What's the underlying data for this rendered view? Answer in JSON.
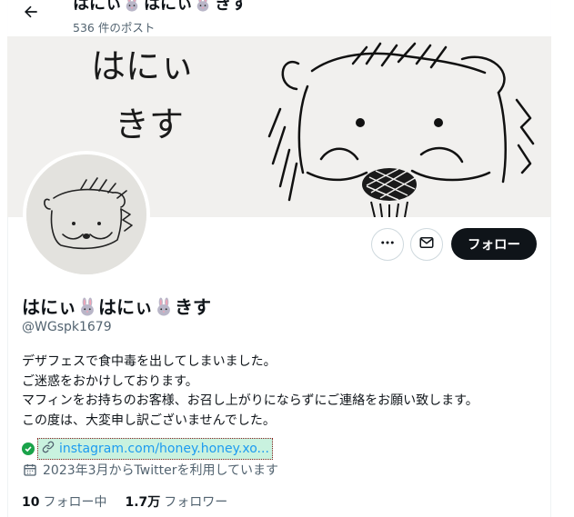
{
  "topbar": {
    "title_part1": "はにぃ",
    "title_part2": "はにぃ",
    "title_part3": "きす",
    "post_count": "536 件のポスト"
  },
  "banner": {
    "handwriting_line1": "はにぃ",
    "handwriting_line2": "きす"
  },
  "profile": {
    "name_part1": "はにぃ",
    "name_part2": "はにぃ",
    "name_part3": "きす",
    "handle": "@WGspk1679",
    "bio": [
      "デザフェスで食中毒を出してしまいました。",
      "ご迷惑をおかけしております。",
      "マフィンをお持ちのお客様、お召し上がりにならずにご連絡をお願い致します。",
      "この度は、大変申し訳ございませんでした。"
    ],
    "link": "instagram.com/honey.honey.xo...",
    "joined": "2023年3月からTwitterを利用しています",
    "following_count": "10",
    "following_label": "フォロー中",
    "followers_count": "1.7万",
    "followers_label": "フォロワー"
  },
  "buttons": {
    "follow_label": "フォロー"
  },
  "icons": {
    "back": "arrow-left-icon",
    "more": "more-dots-icon",
    "message": "envelope-icon",
    "verified_link": "check-circle-icon",
    "link": "link-icon",
    "calendar": "calendar-icon",
    "emoji": "rabbit-emoji-icon"
  },
  "colors": {
    "text": "#0f1419",
    "secondary": "#536471",
    "link": "#1d9bf0",
    "follow_bg": "#0f1419",
    "link_highlight": "#c9f2df",
    "check_green": "#1aa34a"
  }
}
